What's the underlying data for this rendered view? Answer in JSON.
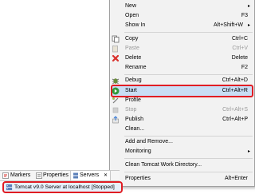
{
  "context_menu": {
    "new": {
      "label": "New",
      "arrow": "▸"
    },
    "open": {
      "label": "Open",
      "shortcut": "F3"
    },
    "show_in": {
      "label": "Show In",
      "shortcut": "Alt+Shift+W",
      "arrow": "▸"
    },
    "copy": {
      "label": "Copy",
      "shortcut": "Ctrl+C"
    },
    "paste": {
      "label": "Paste",
      "shortcut": "Ctrl+V"
    },
    "delete": {
      "label": "Delete",
      "shortcut": "Delete"
    },
    "rename": {
      "label": "Rename",
      "shortcut": "F2"
    },
    "debug": {
      "label": "Debug",
      "shortcut": "Ctrl+Alt+D"
    },
    "start": {
      "label": "Start",
      "shortcut": "Ctrl+Alt+R"
    },
    "profile": {
      "label": "Profile"
    },
    "stop": {
      "label": "Stop",
      "shortcut": "Ctrl+Alt+S"
    },
    "publish": {
      "label": "Publish",
      "shortcut": "Ctrl+Alt+P"
    },
    "clean": {
      "label": "Clean..."
    },
    "add_remove": {
      "label": "Add and Remove..."
    },
    "monitoring": {
      "label": "Monitoring",
      "arrow": "▸"
    },
    "clean_work_dir": {
      "label": "Clean Tomcat Work Directory..."
    },
    "properties": {
      "label": "Properties",
      "shortcut": "Alt+Enter"
    }
  },
  "views": {
    "tabs": [
      {
        "label": "Markers",
        "icon": "markers-icon"
      },
      {
        "label": "Properties",
        "icon": "properties-icon"
      },
      {
        "label": "Servers",
        "icon": "servers-icon",
        "active": true,
        "close": "✕"
      }
    ]
  },
  "servers": {
    "row_label": "Tomcat v9.0 Server at localhost  [Stopped]"
  },
  "colors": {
    "highlight_border": "#e01d24",
    "selected_bg": "#c9def5",
    "start_icon": "#2f9a3a",
    "delete_icon": "#d9302b",
    "debug_icon": "#6a8d3a"
  }
}
